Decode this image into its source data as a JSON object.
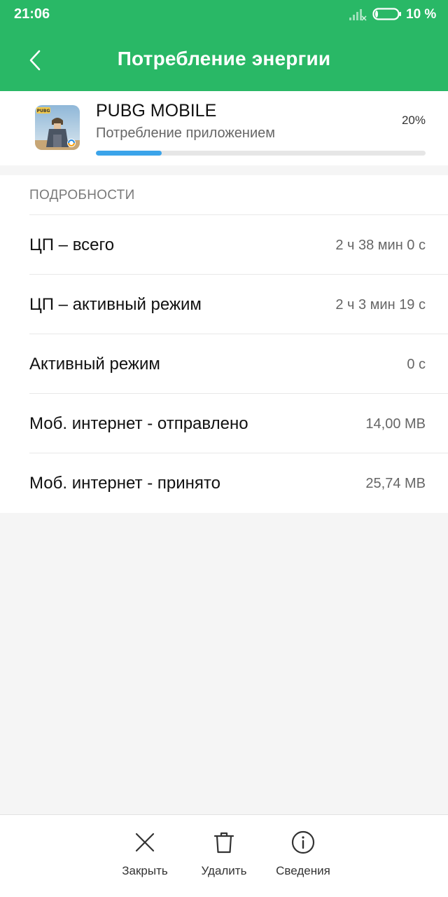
{
  "status_bar": {
    "time": "21:06",
    "battery_text": "10 %",
    "battery_level": 0.1
  },
  "header": {
    "title": "Потребление энергии",
    "back_icon": "chevron-left-icon",
    "background": "#29b866"
  },
  "app": {
    "name": "PUBG MOBILE",
    "subtitle": "Потребление приложением",
    "percent_text": "20%",
    "usage_fraction": 0.2,
    "bar_color": "#3ba4ea"
  },
  "details": {
    "heading": "ПОДРОБНОСТИ",
    "rows": [
      {
        "label": "ЦП – всего",
        "value": "2 ч 38 мин 0 с"
      },
      {
        "label": "ЦП – активный режим",
        "value": "2 ч 3 мин 19 с"
      },
      {
        "label": "Активный режим",
        "value": "0 с"
      },
      {
        "label": "Моб. интернет - отправлено",
        "value": "14,00 MB"
      },
      {
        "label": "Моб. интернет - принято",
        "value": "25,74 MB"
      }
    ]
  },
  "actions": [
    {
      "label": "Закрыть",
      "icon": "close-icon"
    },
    {
      "label": "Удалить",
      "icon": "trash-icon"
    },
    {
      "label": "Сведения",
      "icon": "info-icon"
    }
  ]
}
